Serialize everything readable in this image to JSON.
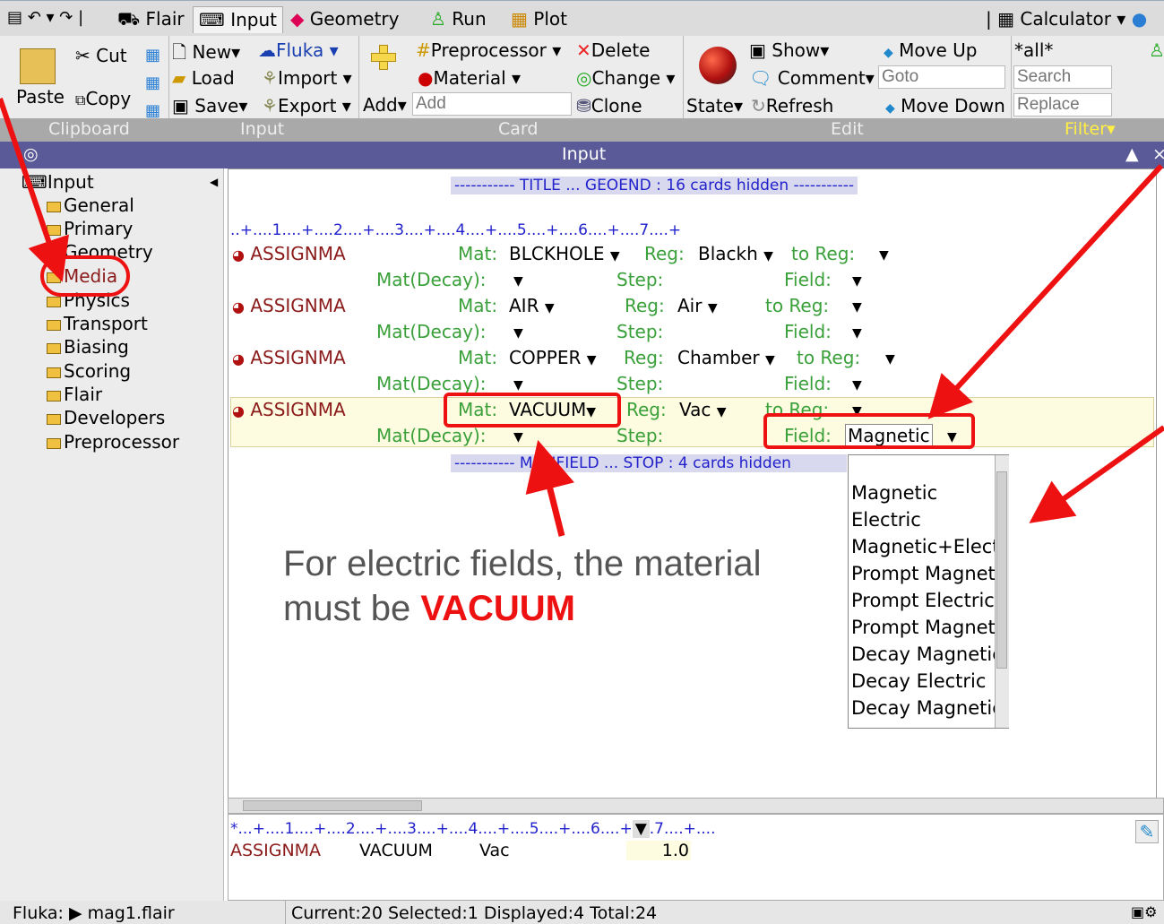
{
  "menubar": {
    "tabs": [
      "Flair",
      "Input",
      "Geometry",
      "Run",
      "Plot"
    ],
    "calculator": "Calculator"
  },
  "ribbon": {
    "clipboard": {
      "paste": "Paste",
      "cut": "Cut",
      "copy": "Copy",
      "group": "Clipboard"
    },
    "input": {
      "new": "New",
      "load": "Load",
      "save": "Save",
      "fluka": "Fluka",
      "import": "Import",
      "export": "Export",
      "group": "Input"
    },
    "card": {
      "add_label": "Add",
      "add_placeholder": "Add",
      "preprocessor": "Preprocessor",
      "material": "Material",
      "delete": "Delete",
      "change": "Change",
      "clone": "Clone",
      "group": "Card"
    },
    "edit": {
      "state": "State",
      "show": "Show",
      "comment": "Comment",
      "refresh": "Refresh",
      "move_up": "Move Up",
      "goto_placeholder": "Goto",
      "move_down": "Move Down",
      "group": "Edit"
    },
    "filter": {
      "all": "*all*",
      "search_placeholder": "Search",
      "replace_placeholder": "Replace",
      "group": "Filter"
    }
  },
  "panel": {
    "title": "Input"
  },
  "tree": {
    "root": "Input",
    "items": [
      "General",
      "Primary",
      "Geometry",
      "Media",
      "Physics",
      "Transport",
      "Biasing",
      "Scoring",
      "Flair",
      "Developers",
      "Preprocessor"
    ]
  },
  "editor": {
    "hidden_top": "----------- TITLE ... GEOEND : 16 cards hidden -----------",
    "ruler": "..+....1....+....2....+....3....+....4....+....5....+....6....+....7....+",
    "cards": [
      {
        "name": "ASSIGNMA",
        "mat": "BLCKHOLE",
        "reg": "Blackh",
        "to_reg": "",
        "field": ""
      },
      {
        "name": "ASSIGNMA",
        "mat": "AIR",
        "reg": "Air",
        "to_reg": "",
        "field": ""
      },
      {
        "name": "ASSIGNMA",
        "mat": "COPPER",
        "reg": "Chamber",
        "to_reg": "",
        "field": ""
      },
      {
        "name": "ASSIGNMA",
        "mat": "VACUUM",
        "reg": "Vac",
        "to_reg": "",
        "field": "Magnetic"
      }
    ],
    "labels": {
      "mat": "Mat:",
      "reg": "Reg:",
      "to_reg": "to Reg:",
      "mat_decay": "Mat(Decay):",
      "step": "Step:",
      "field": "Field:"
    },
    "hidden_bottom": "----------- MGNFIELD ... STOP : 4 cards hidden",
    "dropdown_options": [
      "Magnetic",
      "Electric",
      "Magnetic+Electric",
      "Prompt Magnetic",
      "Prompt Electric",
      "Prompt Magnetic",
      "Decay Magnetic",
      "Decay Electric",
      "Decay Magnetic"
    ]
  },
  "annotation": {
    "line1": "For electric fields, the material",
    "line2_prefix": "must be ",
    "line2_emph": "VACUUM"
  },
  "bottom_editor": {
    "ruler": "*...+....1....+....2....+....3....+....4....+....5....+....6....+",
    "ruler_tail": ".7....+....",
    "card": "ASSIGNMA",
    "mat": "VACUUM",
    "reg": "Vac",
    "value": "1.0"
  },
  "status": {
    "left": "Fluka: ▶ mag1.flair",
    "main": "Current:20 Selected:1 Displayed:4 Total:24"
  },
  "colors": {
    "accent_red": "#ee1111",
    "label_green": "#3aa03a",
    "card_red": "#8b1a1a",
    "panel_blue": "#5a5a98"
  }
}
